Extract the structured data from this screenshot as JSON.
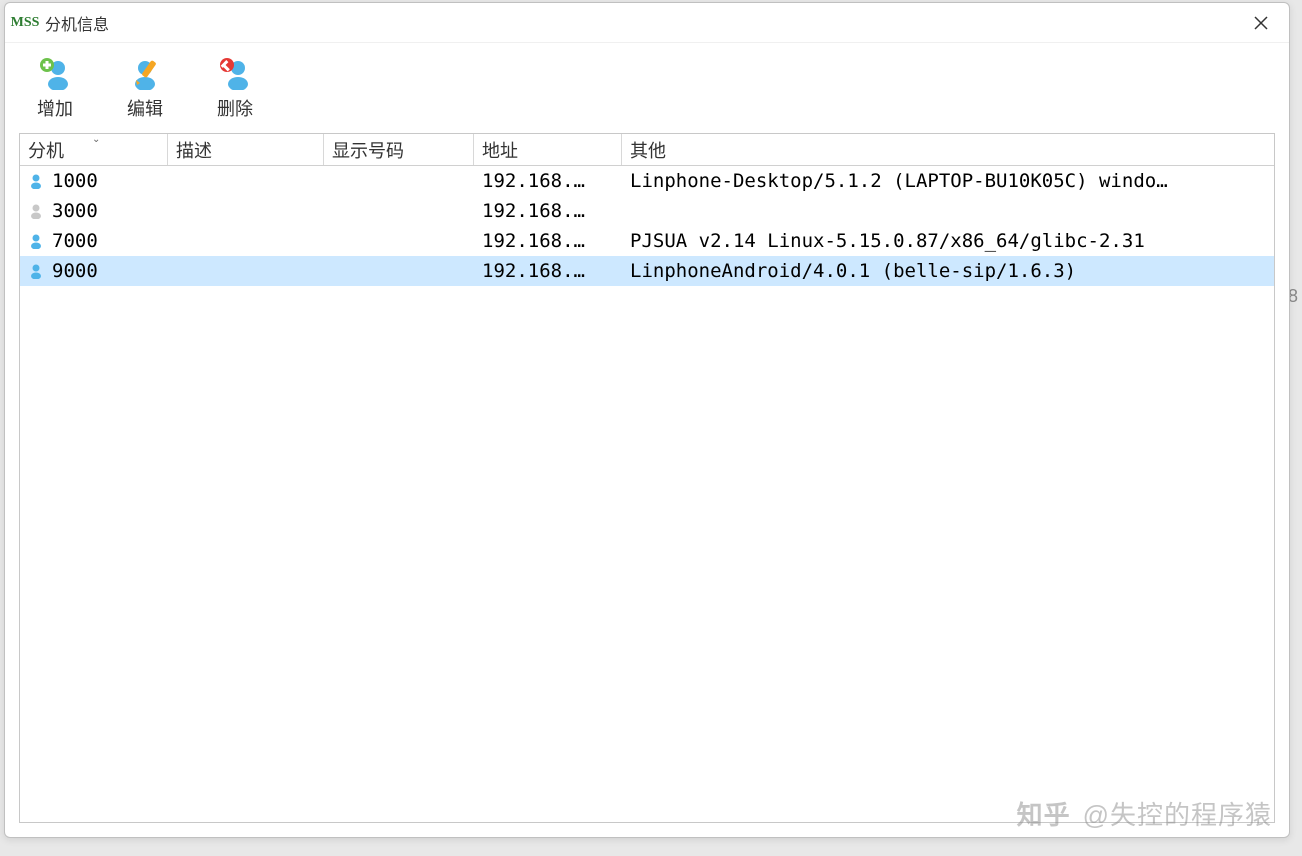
{
  "window": {
    "app_icon_text": "MSS",
    "title": "分机信息"
  },
  "toolbar": {
    "add_label": "增加",
    "edit_label": "编辑",
    "delete_label": "删除"
  },
  "table": {
    "headers": {
      "extension": "分机",
      "description": "描述",
      "display_number": "显示号码",
      "address": "地址",
      "other": "其他"
    },
    "rows": [
      {
        "extension": "1000",
        "description": "",
        "display_number": "",
        "address": "192.168.…",
        "other": "Linphone-Desktop/5.1.2 (LAPTOP-BU10K05C) windo…",
        "online": true,
        "selected": false
      },
      {
        "extension": "3000",
        "description": "",
        "display_number": "",
        "address": "192.168.…",
        "other": "",
        "online": false,
        "selected": false
      },
      {
        "extension": "7000",
        "description": "",
        "display_number": "",
        "address": "192.168.…",
        "other": "PJSUA v2.14 Linux-5.15.0.87/x86_64/glibc-2.31",
        "online": true,
        "selected": false
      },
      {
        "extension": "9000",
        "description": "",
        "display_number": "",
        "address": "192.168.…",
        "other": "LinphoneAndroid/4.0.1 (belle-sip/1.6.3)",
        "online": true,
        "selected": true
      }
    ]
  },
  "watermark": {
    "logo": "知乎",
    "text": "@失控的程序猿"
  },
  "bg_char": "8"
}
